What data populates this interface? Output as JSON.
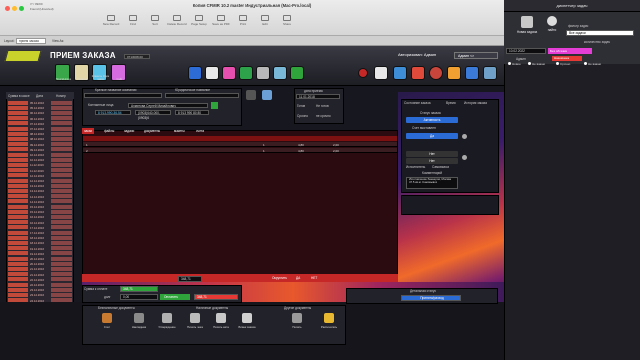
{
  "window": {
    "title": "Копия CFMIR 10.2 master Индустриальная (Mac-Pro.local)",
    "user_line1": "7/ / 09/00",
    "user_line2": "Found (Unsorted)",
    "toolbar": [
      "New Record",
      "Find",
      "Sort",
      "Delete Record",
      "Page Setup",
      "Save as PDF",
      "Print",
      "Edit",
      "Share"
    ],
    "sub_labels": [
      "Layout:",
      "прием заказа",
      "View As:"
    ]
  },
  "header": {
    "title": "ПРИЕМ ЗАКАЗА",
    "order_number": "0713008.00",
    "auth_label": "Авторизован: Админ",
    "admin_select": "Админ <>",
    "big_buttons": [
      "Поиск/Новое",
      "Клиенты",
      "Клиенты Один заказ",
      "Сайт"
    ]
  },
  "left_list": {
    "headers": [
      "Сумма в кассе",
      "Дата",
      "Номер"
    ],
    "rows": [
      {
        "date": "05.12.2016"
      },
      {
        "date": "05.12.2016"
      },
      {
        "date": "06.12.2016"
      },
      {
        "date": "06.12.2016"
      },
      {
        "date": "07.12.2016"
      },
      {
        "date": "07.12.2016"
      },
      {
        "date": "08.12.2016"
      },
      {
        "date": "08.12.2016"
      },
      {
        "date": "09.12.2016"
      },
      {
        "date": "09.12.2016"
      },
      {
        "date": "10.12.2016"
      },
      {
        "date": "10.12.2016"
      },
      {
        "date": "11.12.2016"
      },
      {
        "date": "11.12.2016"
      },
      {
        "date": "12.12.2016"
      },
      {
        "date": "12.12.2016"
      },
      {
        "date": "13.12.2016"
      },
      {
        "date": "13.12.2016"
      },
      {
        "date": "14.12.2016"
      },
      {
        "date": "14.12.2016"
      },
      {
        "date": "15.12.2016"
      },
      {
        "date": "15.12.2016"
      },
      {
        "date": "16.12.2016"
      },
      {
        "date": "16.12.2016"
      },
      {
        "date": "17.12.2016"
      },
      {
        "date": "17.12.2016"
      },
      {
        "date": "18.12.2016"
      },
      {
        "date": "18.12.2016"
      },
      {
        "date": "19.12.2016"
      },
      {
        "date": "19.12.2016"
      },
      {
        "date": "20.12.2016"
      },
      {
        "date": "20.12.2016"
      },
      {
        "date": "21.12.2016"
      },
      {
        "date": "21.12.2016"
      },
      {
        "date": "22.12.2016"
      },
      {
        "date": "22.12.2016"
      },
      {
        "date": "23.12.2016"
      },
      {
        "date": "23.12.2016"
      },
      {
        "date": "24.12.2016"
      },
      {
        "date": "24.12.2016"
      },
      {
        "date": "25.12.2016"
      },
      {
        "date": "25.12.2016"
      }
    ],
    "footer_left": "0",
    "footer_right": "134162"
  },
  "client": {
    "short_name_label": "Краткое название компании",
    "legal_label": "Юридическое название",
    "contact_label": "Контактные лица",
    "contact_name": "Ахмятова Сергей Михайлович",
    "phone": "8 913-990-36-54",
    "phone2": "(0903)640-000, (0903)6",
    "phone3": "8 913 990 80 80",
    "date_label": "дата приема",
    "date_value": "11.01.2018",
    "urgent_label": "Срочно",
    "urgent_value": "не срочно",
    "ready_label": "Готов",
    "ready_value": "Не готов"
  },
  "tabs": [
    "заказ",
    "файлы",
    "задачи",
    "документы",
    "макеты",
    "счета"
  ],
  "table_rows": [
    {
      "num": "1",
      "qty": "1",
      "price": "4,80",
      "sum": "2,00"
    },
    {
      "num": "2",
      "qty": "1",
      "price": "4,80",
      "sum": "2,00"
    }
  ],
  "right_panel": {
    "tabs": [
      "Состояние заказа",
      "Время",
      "История заказа"
    ],
    "order_status_label": "Статус заказа",
    "status_btn": "Активность",
    "invoice_label": "Счет выставлен",
    "status_tags": [
      "Да",
      "Нет",
      "Нет"
    ],
    "executor_label": "Исполнитель",
    "executor_value": "Самовывоз",
    "comment_label": "Комментарий",
    "comment_text": "Изготовление баннеров, Москва 47.5 кв.м. Самовывоз"
  },
  "totals": {
    "label_sum": "Сумма к оплате",
    "sum_value": "348,71",
    "debt_label": "долг",
    "paid_value": "0,00",
    "pay_btn": "Оплатить",
    "pay_value": "348,71",
    "total_row": "348,71",
    "rounding_label": "Округлить",
    "yes": "ДА",
    "no": "НЕТ"
  },
  "bottom": {
    "docs_label": "Безналичные документы",
    "cash_label": "Наличные документы",
    "other_label": "Другие документы",
    "detail_label": "Детальная статус",
    "detail_value": "Принята/разход",
    "buttons": [
      "Счет",
      "Накладная",
      "Утверждение",
      "Печать чека",
      "Печать акта",
      "Бланк заказа",
      "Печать",
      "Распечатать"
    ]
  },
  "tasks": {
    "title": "диспетчер задач",
    "new_task": "Новая задача",
    "find": "найти",
    "filter_label": "фильтр задач",
    "filter_value": "Все задачи",
    "count_label": "количество задач",
    "date": "10.02.2022",
    "col_admin": "Админ",
    "col_status": "Назначена",
    "row_admin": "Админ",
    "tag": "Без обтяжки",
    "task_line": "Назначена",
    "radio_labels": [
      "Новое",
      "Не важно",
      "Срочно",
      "Не важно"
    ],
    "radio_labels2": [
      "Не важно",
      "Срочно",
      "Не важно"
    ]
  },
  "colors": {
    "accent_green": "#2fa43a",
    "accent_red": "#c62828",
    "header_bg": "#2a2a33"
  }
}
